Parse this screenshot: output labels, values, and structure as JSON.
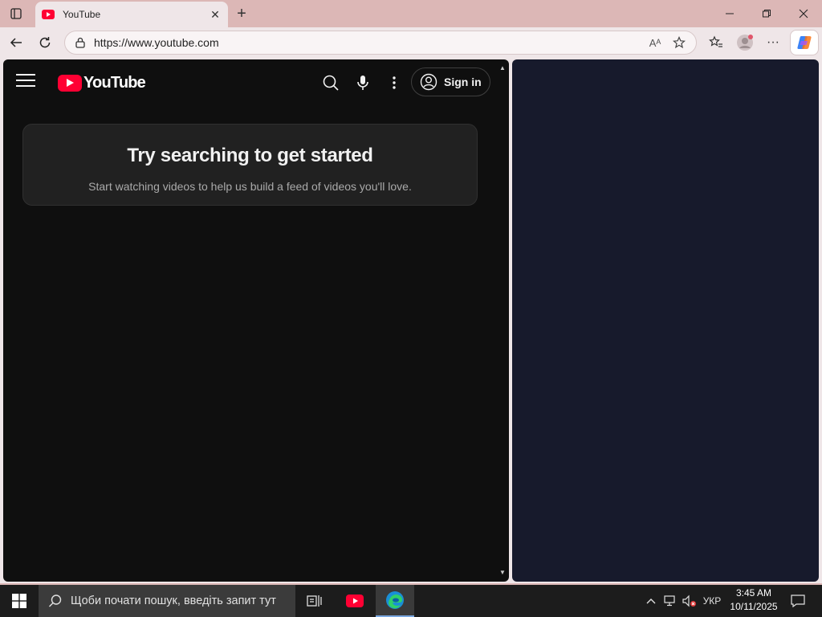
{
  "browser": {
    "tab": {
      "title": "YouTube",
      "close_symbol": "✕"
    },
    "new_tab_symbol": "+",
    "window_controls": {
      "minimize": "—",
      "restore": "❐",
      "close": "✕"
    },
    "address": {
      "url": "https://www.youtube.com"
    },
    "omnibox_icons": {
      "read_aloud": "Aᴬ",
      "favorite": "☆"
    },
    "toolbar_icons": {
      "favorites": "☆≡",
      "more": "···"
    }
  },
  "youtube": {
    "logo_text": "YouTube",
    "signin_label": "Sign in",
    "empty_state": {
      "title": "Try searching to get started",
      "subtitle": "Start watching videos to help us build a feed of videos you'll love."
    },
    "colors": {
      "background": "#0f0f0f",
      "brand_red": "#ff0033",
      "card": "#212121"
    }
  },
  "side_panel": {
    "color": "#171a2c"
  },
  "taskbar": {
    "search_placeholder": "Щоби почати пошук, введіть запит тут",
    "language": "УКР",
    "time": "3:45 AM",
    "date": "10/11/2025"
  }
}
